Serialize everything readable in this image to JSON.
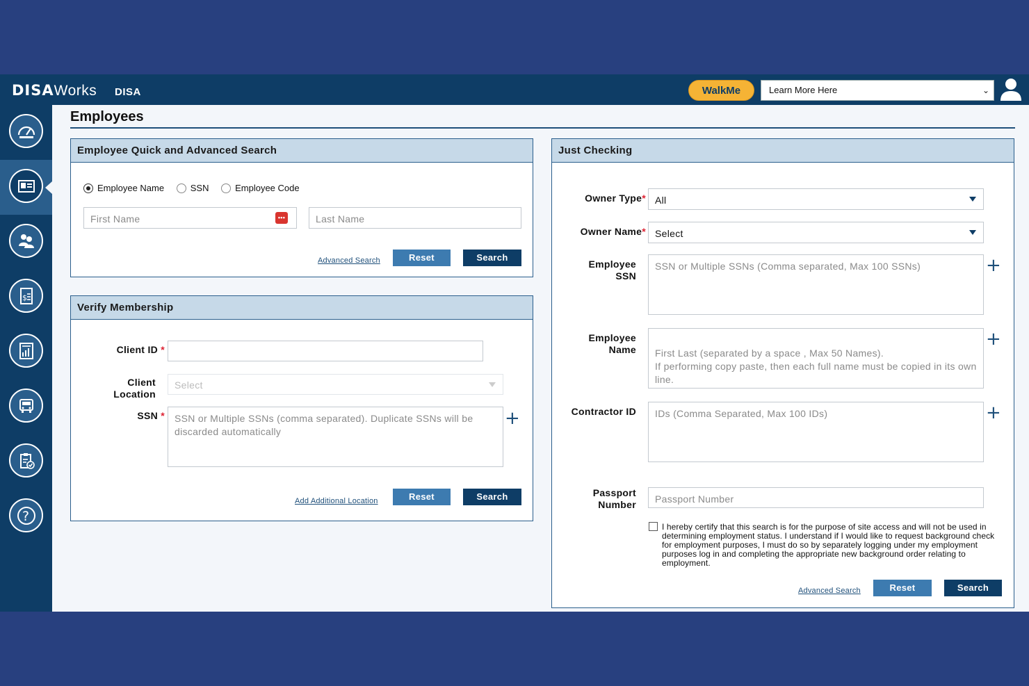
{
  "header": {
    "logo_bold": "DISA",
    "logo_light": "Works",
    "org": "DISA",
    "walkme": "WalkMe",
    "learn_more": "Learn More Here"
  },
  "page": {
    "title": "Employees"
  },
  "quick_search": {
    "title": "Employee Quick and Advanced Search",
    "radios": [
      "Employee Name",
      "SSN",
      "Employee Code"
    ],
    "selected": "Employee Name",
    "first_name_placeholder": "First Name",
    "last_name_placeholder": "Last Name",
    "advanced_link": "Advanced Search",
    "reset": "Reset",
    "search": "Search"
  },
  "verify": {
    "title": "Verify Membership",
    "client_id_label": "Client ID",
    "client_location_label": "Client Location",
    "client_location_value": "Select",
    "ssn_label": "SSN",
    "ssn_placeholder": "SSN or Multiple SSNs (comma separated). Duplicate SSNs will be discarded automatically",
    "add_location_link": "Add Additional Location",
    "reset": "Reset",
    "search": "Search"
  },
  "just_checking": {
    "title": "Just Checking",
    "owner_type_label": "Owner Type",
    "owner_type_value": "All",
    "owner_name_label": "Owner Name",
    "owner_name_value": "Select",
    "employee_ssn_label": "Employee SSN",
    "employee_ssn_placeholder": "SSN or Multiple SSNs (Comma separated, Max 100 SSNs)",
    "employee_name_label": "Employee Name",
    "employee_name_placeholder": "First Last (separated by a space , Max 50 Names).\nIf performing copy paste, then each full name must be copied in its own line.",
    "contractor_label": "Contractor ID",
    "contractor_placeholder": "IDs (Comma Separated, Max 100 IDs)",
    "passport_label": "Passport Number",
    "passport_placeholder": "Passport Number",
    "certify_text": "I hereby certify that this search is for the purpose of site access and will not be used in determining employment status. I understand if I would like to request background check for employment purposes, I must do so by separately logging under my employment purposes log in and completing the appropriate new background order relating to employment.",
    "advanced_link": "Advanced Search",
    "reset": "Reset",
    "search": "Search"
  },
  "sidebar": {
    "items": [
      "dashboard-icon",
      "employee-id-card-icon",
      "people-group-icon",
      "invoice-icon",
      "reports-chart-icon",
      "vehicle-icon",
      "clipboard-check-icon",
      "help-icon"
    ],
    "active_index": 1
  }
}
